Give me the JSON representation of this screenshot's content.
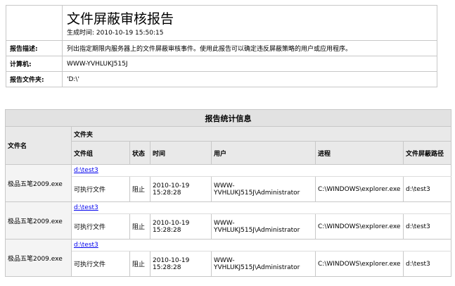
{
  "report": {
    "title": "文件屏蔽审核报告",
    "generated": "生成时间: 2010-10-19 15:50:15",
    "fields": [
      {
        "label": "报告描述:",
        "value": "列出指定期限内服务器上的文件屏蔽审核事件。使用此报告可以确定违反屏蔽策略的用户或应用程序。"
      },
      {
        "label": "计算机:",
        "value": "WWW-YVHLUKJ515J"
      },
      {
        "label": "报告文件夹:",
        "value": "'D:\\'"
      }
    ]
  },
  "stats": {
    "caption": "报告统计信息",
    "headers": {
      "filename": "文件名",
      "folder": "文件夹",
      "group": "文件组",
      "state": "状态",
      "time": "时间",
      "user": "用户",
      "process": "进程",
      "screen_path": "文件屏蔽路径"
    },
    "rows": [
      {
        "filename": "极品五笔2009.exe",
        "folder": "d:\\test3",
        "group": "可执行文件",
        "state": "阻止",
        "time": "2010-10-19 15:28:28",
        "user": "WWW-YVHLUKJ515J\\Administrator",
        "process": "C:\\WINDOWS\\explorer.exe",
        "screen_path": "d:\\test3"
      },
      {
        "filename": "极品五笔2009.exe",
        "folder": "d:\\test3",
        "group": "可执行文件",
        "state": "阻止",
        "time": "2010-10-19 15:28:28",
        "user": "WWW-YVHLUKJ515J\\Administrator",
        "process": "C:\\WINDOWS\\explorer.exe",
        "screen_path": "d:\\test3"
      },
      {
        "filename": "极品五笔2009.exe",
        "folder": "d:\\test3",
        "group": "可执行文件",
        "state": "阻止",
        "time": "2010-10-19 15:28:28",
        "user": "WWW-YVHLUKJ515J\\Administrator",
        "process": "C:\\WINDOWS\\explorer.exe",
        "screen_path": "d:\\test3"
      }
    ]
  }
}
